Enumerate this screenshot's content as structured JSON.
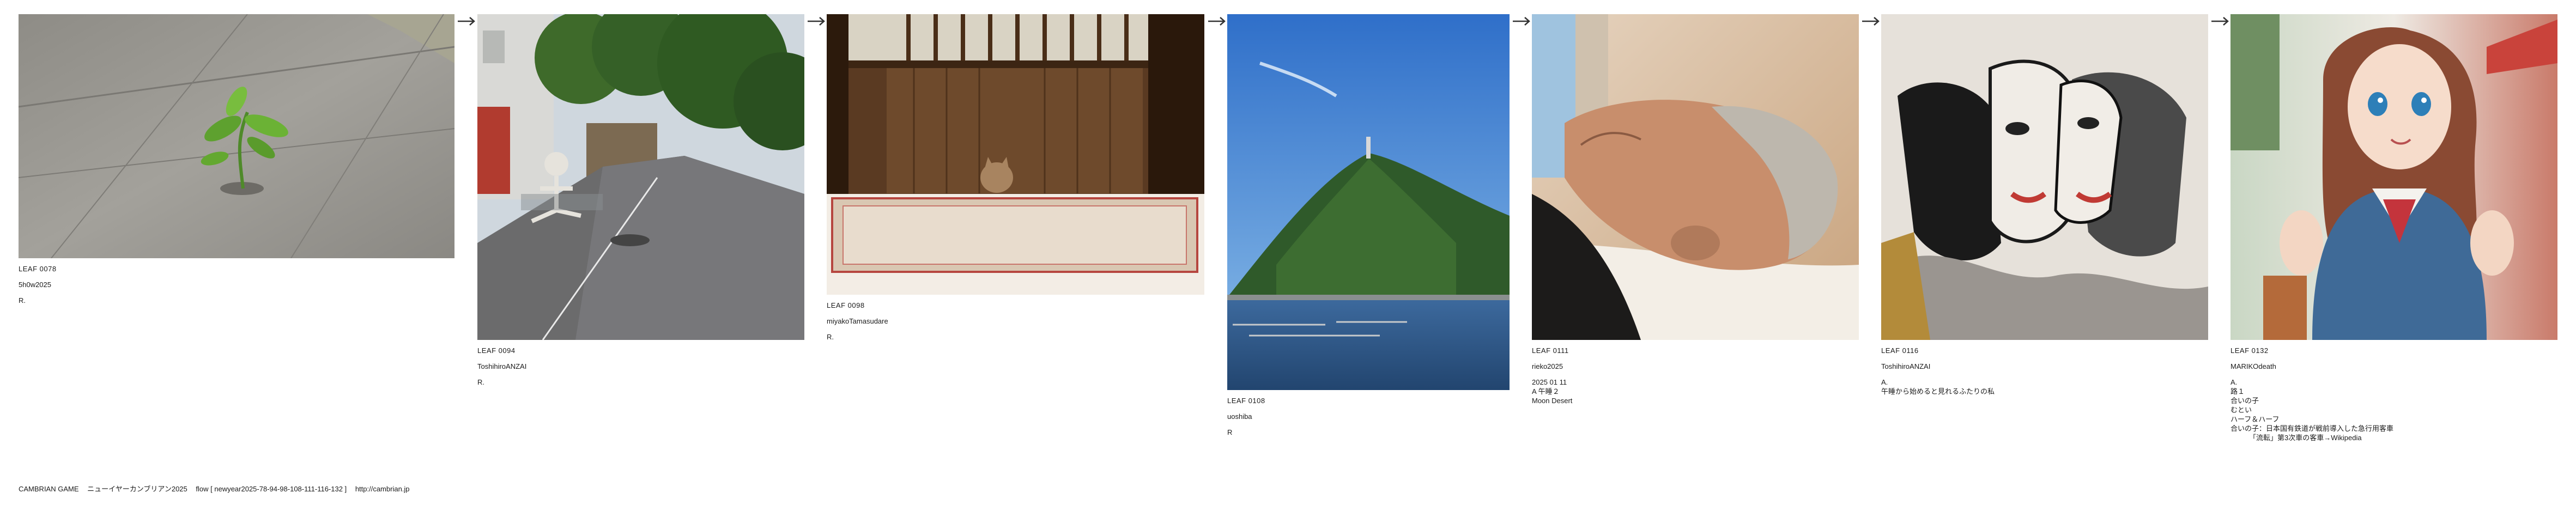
{
  "leaves": [
    {
      "id": "LEAF 0078",
      "author": "5h0w2025",
      "lines": [
        "R."
      ],
      "image": "sprouting-plant-in-pavement-photo"
    },
    {
      "id": "LEAF 0094",
      "author": "ToshihiroANZAI",
      "lines": [
        "R."
      ],
      "image": "street-with-skeleton-photo"
    },
    {
      "id": "LEAF 0098",
      "author": "miyakoTamasudare",
      "lines": [
        "R."
      ],
      "image": "cat-behind-wooden-gate-photo"
    },
    {
      "id": "LEAF 0108",
      "author": "uoshiba",
      "lines": [
        "R"
      ],
      "image": "island-hill-over-bay-photo"
    },
    {
      "id": "LEAF 0111",
      "author": "rieko2025",
      "lines": [
        "2025 01 11",
        "A 午睡２",
        "Moon Desert"
      ],
      "image": "sleeping-elderly-man-photo"
    },
    {
      "id": "LEAF 0116",
      "author": "ToshihiroANZAI",
      "lines": [
        "A.",
        "午睡から始めると見れるふたりの私"
      ],
      "image": "cubist-two-faces-painting"
    },
    {
      "id": "LEAF 0132",
      "author": "MARIKOdeath",
      "lines": [
        "A.",
        "路１",
        "合いの子",
        "むとい",
        "ハーフ＆ハーフ",
        "合いの子：日本国有鉄道が戦前導入した急行用客車",
        "「流転」第3次車の客車→Wikipedia"
      ],
      "image": "anime-schoolgirl-illustration"
    }
  ],
  "arrow_glyph": "→",
  "footer": {
    "game": "CAMBRIAN GAME",
    "event": "ニューイヤーカンブリアン2025",
    "flow": "flow [ newyear2025-78-94-98-108-111-116-132 ]",
    "url": "http://cambrian.jp"
  }
}
